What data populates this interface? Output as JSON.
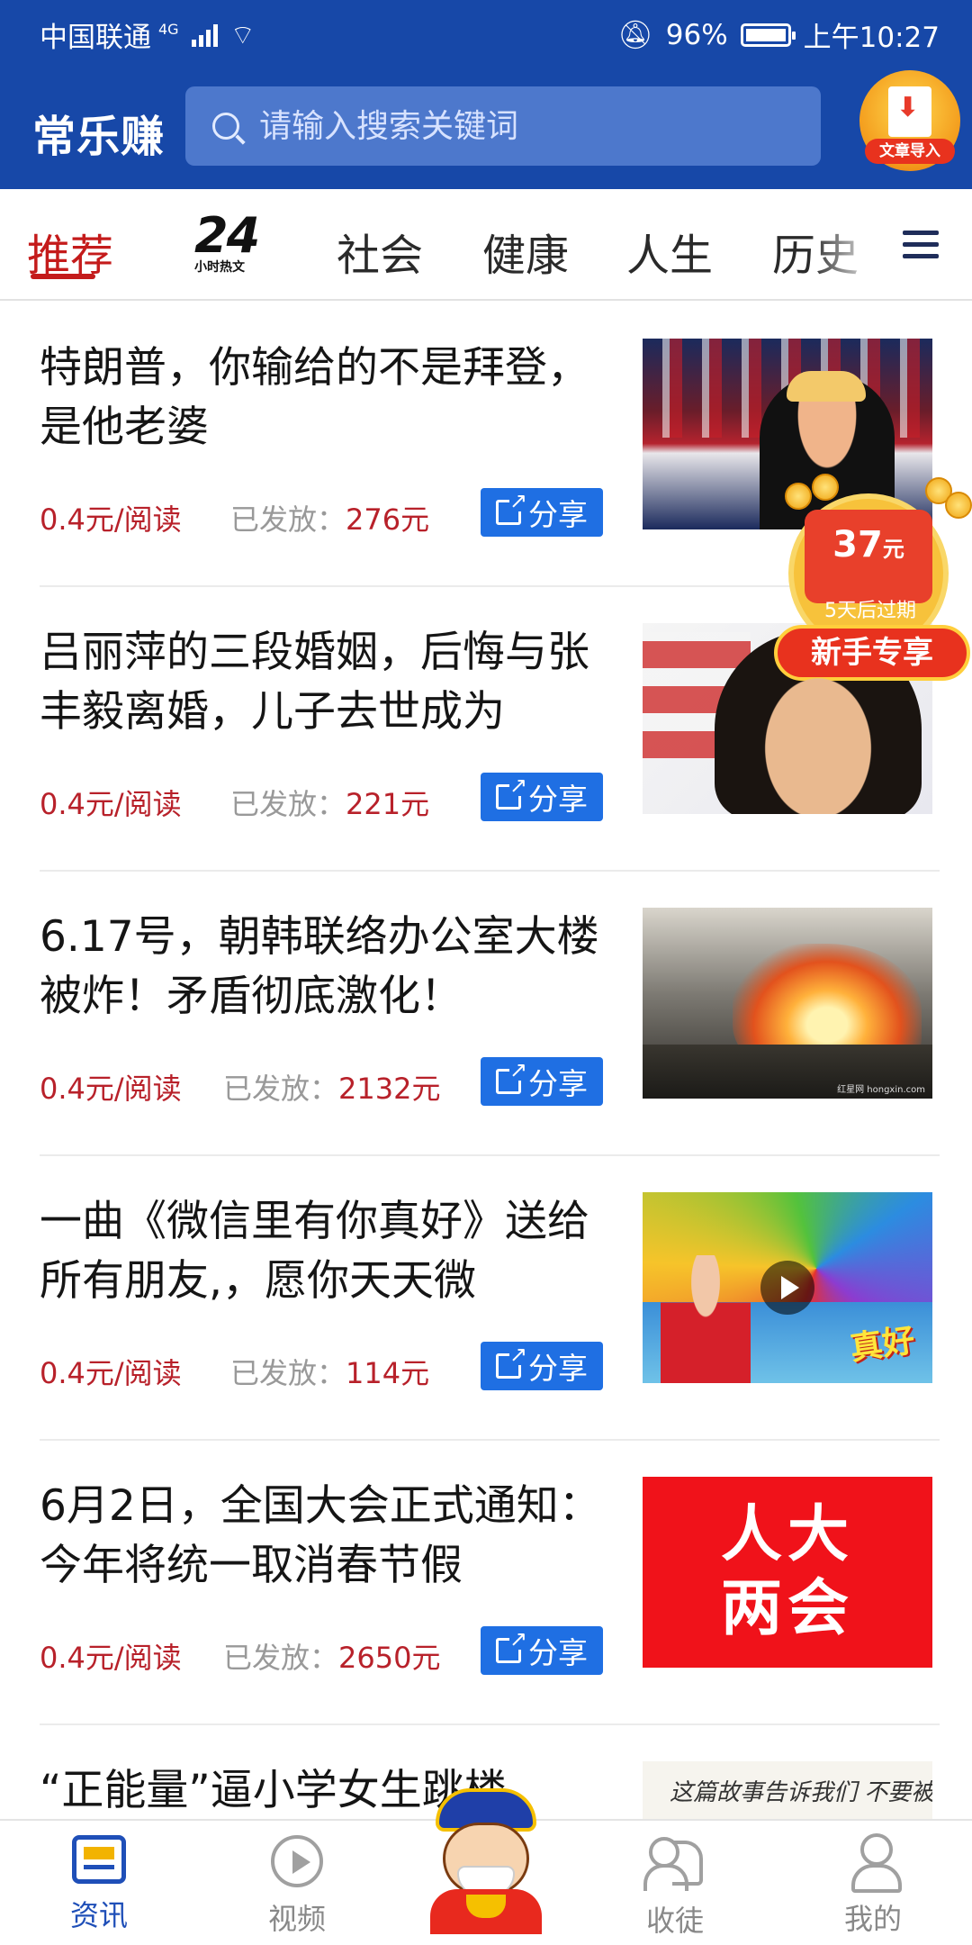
{
  "status_bar": {
    "carrier": "中国联通",
    "network": "4G",
    "battery": "96%",
    "time": "上午10:27"
  },
  "header": {
    "logo": "常乐赚",
    "search_placeholder": "请输入搜索关键词",
    "import_label": "文章导入"
  },
  "tabs": [
    {
      "label": "推荐",
      "active": true
    },
    {
      "label": "24",
      "sub": "小时热文"
    },
    {
      "label": "社会"
    },
    {
      "label": "健康"
    },
    {
      "label": "人生"
    },
    {
      "label": "历史"
    }
  ],
  "feed": [
    {
      "title": "特朗普，你输给的不是拜登，是他老婆",
      "rate": "0.4元/阅读",
      "paid_label": "已发放：",
      "paid_amount": "276元",
      "share": "分享"
    },
    {
      "title": "吕丽萍的三段婚姻，后悔与张丰毅离婚，儿子去世成为",
      "rate": "0.4元/阅读",
      "paid_label": "已发放：",
      "paid_amount": "221元",
      "share": "分享"
    },
    {
      "title": "6.17号，朝韩联络办公室大楼被炸！矛盾彻底激化！",
      "rate": "0.4元/阅读",
      "paid_label": "已发放：",
      "paid_amount": "2132元",
      "share": "分享",
      "thumb_watermark": "红星网 hongxin.com"
    },
    {
      "title": "一曲《微信里有你真好》送给所有朋友,，愿你天天微",
      "rate": "0.4元/阅读",
      "paid_label": "已发放：",
      "paid_amount": "114元",
      "share": "分享",
      "thumb_text": "真好"
    },
    {
      "title": "6月2日，全国大会正式通知：今年将统一取消春节假",
      "rate": "0.4元/阅读",
      "paid_label": "已发放：",
      "paid_amount": "2650元",
      "share": "分享",
      "thumb_text_1": "人大",
      "thumb_text_2": "两会"
    },
    {
      "title": "“正能量”逼小学女生跳楼",
      "thumb_text": "这篇故事告诉我们 不要被表面"
    }
  ],
  "promo": {
    "amount": "37",
    "unit": "元",
    "expire": "5天后过期",
    "label": "新手专享"
  },
  "bottom_nav": [
    {
      "label": "资讯",
      "icon": "news-icon",
      "active": true
    },
    {
      "label": "视频",
      "icon": "video-icon"
    },
    {
      "label": "",
      "icon": "god-of-wealth-icon"
    },
    {
      "label": "收徒",
      "icon": "apprentice-icon"
    },
    {
      "label": "我的",
      "icon": "profile-icon"
    }
  ],
  "colors": {
    "brand_blue": "#1748a8",
    "accent_red": "#c41b1b",
    "share_blue": "#1f6fe3",
    "nav_active": "#1f4fb8"
  }
}
